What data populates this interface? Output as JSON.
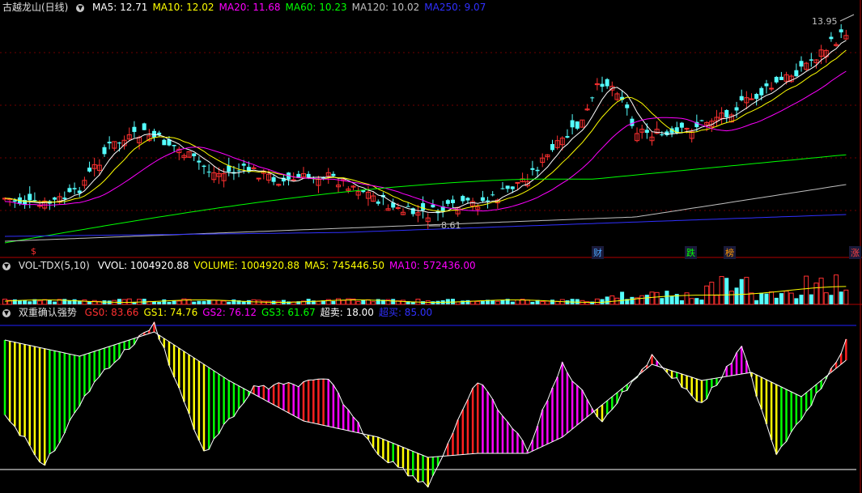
{
  "main_panel": {
    "title": "古越龙山(日线)",
    "ma": [
      {
        "label": "MA5: 12.71",
        "color": "#ffffff"
      },
      {
        "label": "MA10: 12.02",
        "color": "#ffff00"
      },
      {
        "label": "MA20: 11.68",
        "color": "#ff00ff"
      },
      {
        "label": "MA60: 10.23",
        "color": "#00ff00"
      },
      {
        "label": "MA120: 10.02",
        "color": "#c0c0c0"
      },
      {
        "label": "MA250: 9.07",
        "color": "#3030ff"
      }
    ],
    "high_label": "13.95",
    "low_label": "8.61",
    "event_marks": [
      {
        "text": "$",
        "color": "#ff3030"
      },
      {
        "text": "财",
        "color": "#4aa8ff"
      },
      {
        "text": "跌",
        "color": "#00ff00"
      },
      {
        "text": "榜",
        "color": "#ff9900"
      },
      {
        "text": "涨",
        "color": "#ff4040"
      }
    ]
  },
  "volume_panel": {
    "indicator": "VOL-TDX(5,10)",
    "values": [
      {
        "label": "VVOL: 1004920.88",
        "color": "#ffffff"
      },
      {
        "label": "VOLUME: 1004920.88",
        "color": "#ffff00"
      },
      {
        "label": "MA5: 745446.50",
        "color": "#ffff00"
      },
      {
        "label": "MA10: 572436.00",
        "color": "#ff00ff"
      }
    ]
  },
  "indicator_panel": {
    "title": "双重确认强势",
    "values": [
      {
        "label": "GS0: 83.66",
        "color": "#ff3030"
      },
      {
        "label": "GS1: 74.76",
        "color": "#ffff00"
      },
      {
        "label": "GS2: 76.12",
        "color": "#ff00ff"
      },
      {
        "label": "GS3: 61.67",
        "color": "#00ff00"
      },
      {
        "label": "超卖: 18.00",
        "color": "#ffffff"
      },
      {
        "label": "超买: 85.00",
        "color": "#3030ff"
      }
    ]
  },
  "chart_data": {
    "type": "candlestick",
    "title": "古越龙山(日线)",
    "price_high": 13.95,
    "price_low": 8.61,
    "last_ma": {
      "MA5": 12.71,
      "MA10": 12.02,
      "MA20": 11.68,
      "MA60": 10.23,
      "MA120": 10.02,
      "MA250": 9.07
    },
    "volume": {
      "VVOL": 1004920.88,
      "VOLUME": 1004920.88,
      "MA5": 745446.5,
      "MA10": 572436.0
    },
    "indicator": {
      "GS0": 83.66,
      "GS1": 74.76,
      "GS2": 76.12,
      "GS3": 61.67,
      "oversold": 18.0,
      "overbought": 85.0
    }
  }
}
